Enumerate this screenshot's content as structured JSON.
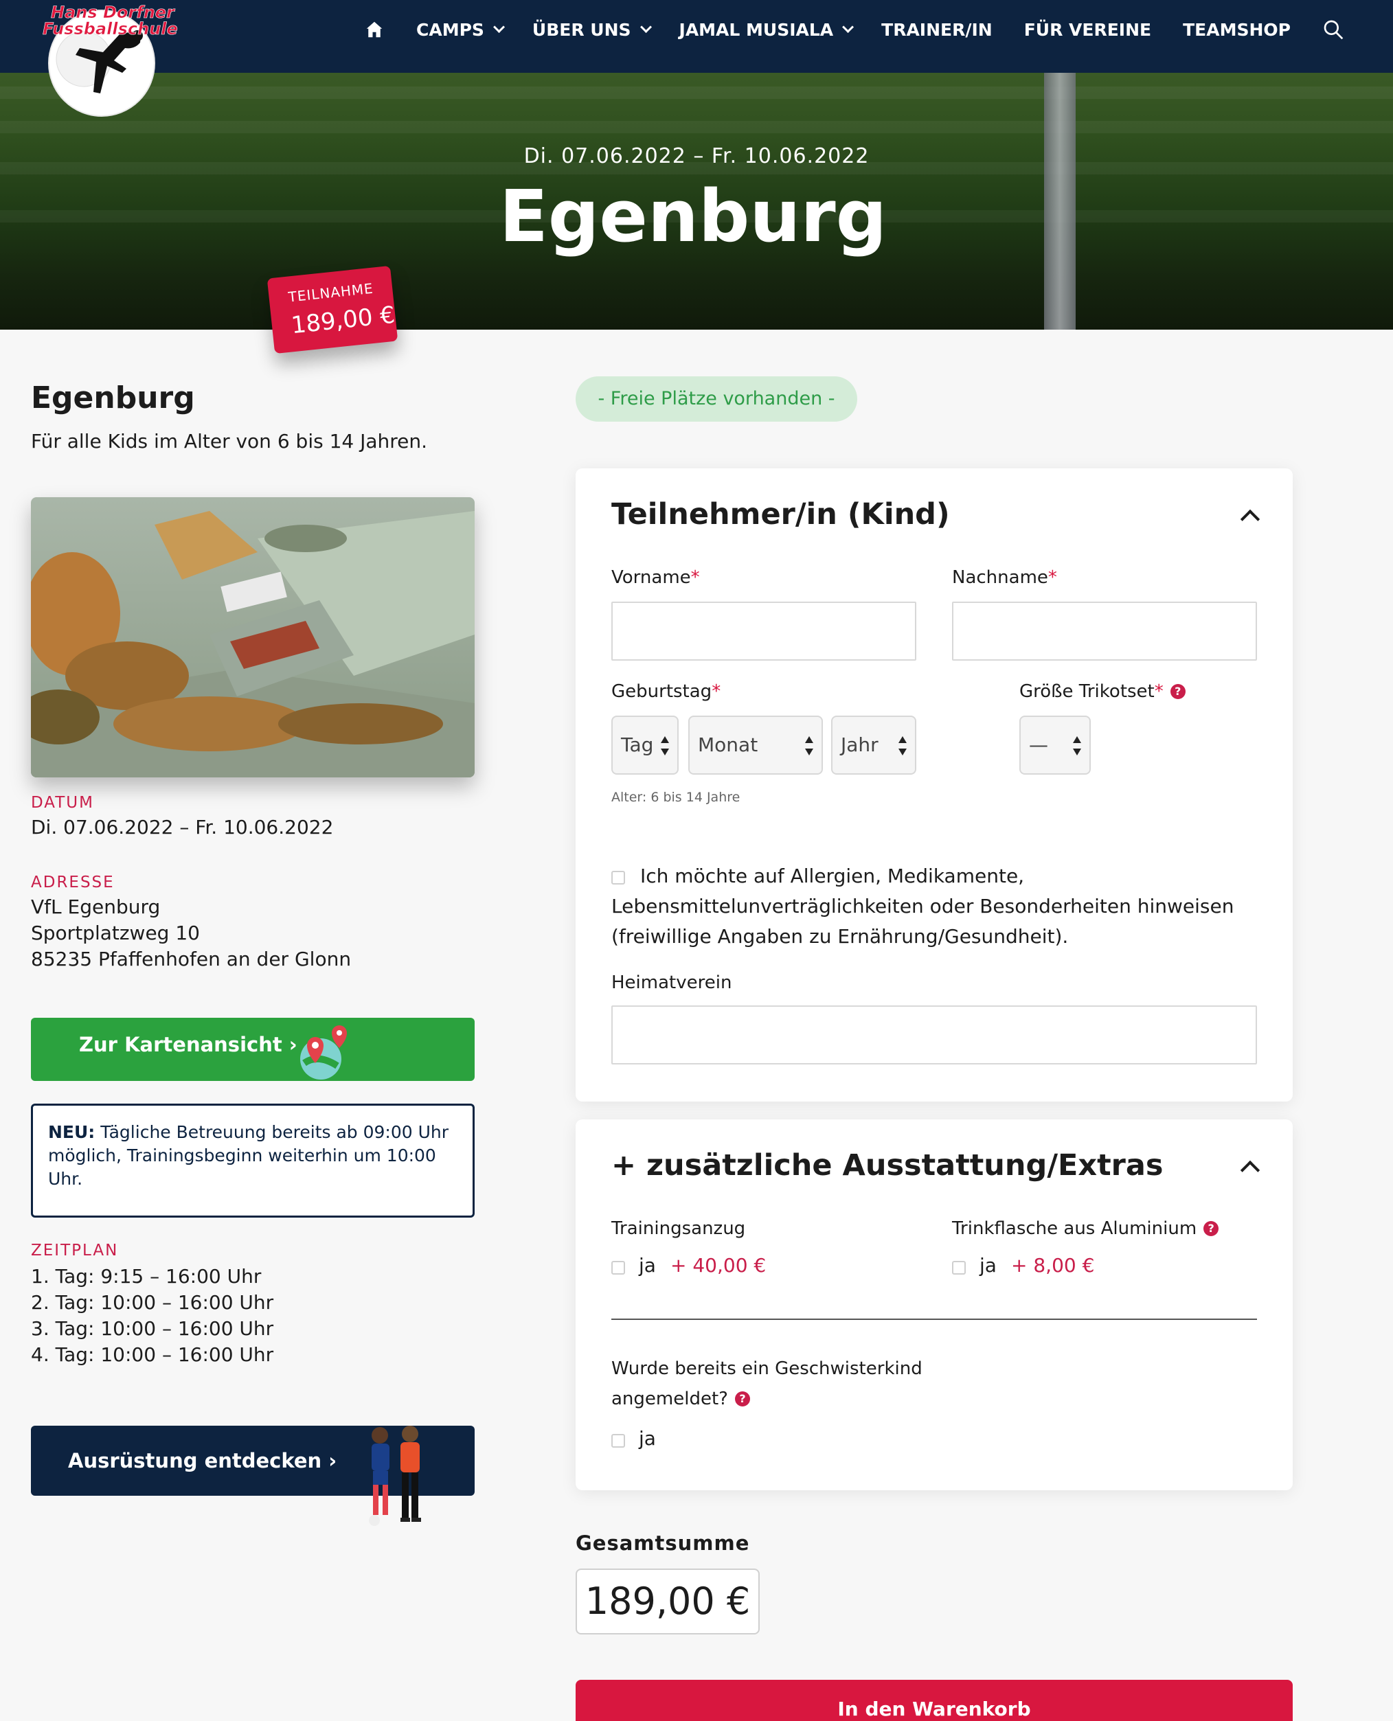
{
  "brand": {
    "logo_line1": "Hans Dorfner",
    "logo_line2": "Fussballschule"
  },
  "nav": {
    "items": [
      {
        "label": "CAMPS",
        "dropdown": true
      },
      {
        "label": "ÜBER UNS",
        "dropdown": true
      },
      {
        "label": "JAMAL MUSIALA",
        "dropdown": true
      },
      {
        "label": "TRAINER/IN",
        "dropdown": false
      },
      {
        "label": "FÜR VEREINE",
        "dropdown": false
      },
      {
        "label": "TEAMSHOP",
        "dropdown": false
      }
    ],
    "home_icon": "home-icon",
    "search_icon": "search-icon"
  },
  "hero": {
    "date": "Di. 07.06.2022 – Fr. 10.06.2022",
    "title": "Egenburg",
    "price_label": "TEILNAHME",
    "price_value": "189,00 €"
  },
  "camp": {
    "title": "Egenburg",
    "subtitle": "Für alle Kids im Alter von 6 bis 14 Jahren.",
    "date_label": "DATUM",
    "date_value": "Di. 07.06.2022 – Fr. 10.06.2022",
    "address_label": "ADRESSE",
    "address_lines": [
      "VfL Egenburg",
      "Sportplatzweg 10",
      "85235 Pfaffenhofen an der Glonn"
    ],
    "map_button": "Zur Kartenansicht ›",
    "notice_bold": "NEU:",
    "notice_text": " Tägliche Betreuung bereits ab 09:00 Uhr möglich, Trainingsbeginn weiterhin um 10:00 Uhr.",
    "schedule_label": "ZEITPLAN",
    "schedule": [
      "1. Tag: 9:15 – 16:00 Uhr",
      "2. Tag: 10:00 – 16:00 Uhr",
      "3. Tag: 10:00 – 16:00 Uhr",
      "4. Tag: 10:00 – 16:00 Uhr"
    ],
    "gear_button": "Ausrüstung entdecken ›"
  },
  "form": {
    "availability": "- Freie Plätze vorhanden -",
    "participant": {
      "title": "Teilnehmer/in (Kind)",
      "first_name_label": "Vorname",
      "last_name_label": "Nachname",
      "first_name_value": "",
      "last_name_value": "",
      "birthday_label": "Geburtstag",
      "day": "Tag",
      "month": "Monat",
      "year": "Jahr",
      "shirt_label": "Größe Trikotset",
      "shirt_value": "—",
      "age_hint": "Alter: 6 bis 14 Jahre",
      "allergy_text": "Ich möchte auf Allergien, Medikamente, Lebensmittelunverträglichkeiten oder Besonderheiten hinweisen (freiwillige Angaben zu Ernährung/Gesundheit).",
      "club_label": "Heimatverein",
      "club_value": ""
    },
    "extras": {
      "title": "+ zusätzliche Ausstattung/Extras",
      "tracksuit_label": "Trainingsanzug",
      "tracksuit_option": "ja",
      "tracksuit_price": "+ 40,00 €",
      "bottle_label": "Trinkflasche aus Aluminium",
      "bottle_option": "ja",
      "bottle_price": "+ 8,00 €",
      "sibling_line1": "Wurde bereits ein Geschwisterkind",
      "sibling_line2": "angemeldet?",
      "sibling_option": "ja"
    },
    "total_label": "Gesamtsumme",
    "total_value": "189,00 €",
    "cart_button": "In den Warenkorb"
  },
  "colors": {
    "navy": "#0d2340",
    "red": "#d8173f",
    "green": "#2ba23e",
    "pill_bg": "#d4ecd8"
  }
}
